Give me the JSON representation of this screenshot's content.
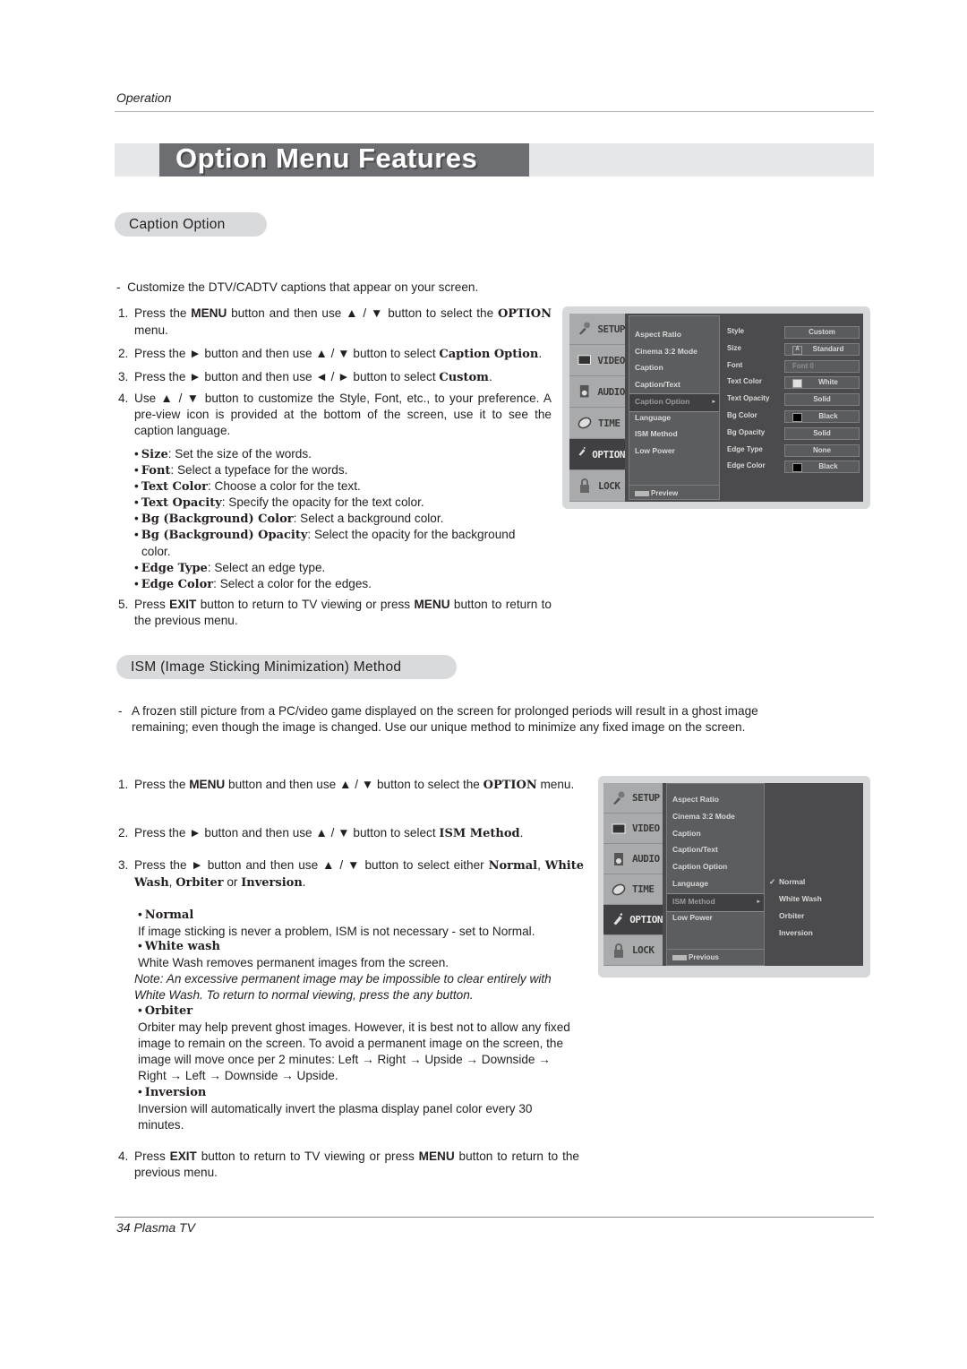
{
  "header": {
    "section": "Operation"
  },
  "title": "Option Menu Features",
  "caption_section": {
    "heading": "Caption Option",
    "intro": "Customize the DTV/CADTV captions that appear on your screen.",
    "steps": [
      {
        "num": "1.",
        "parts": [
          "Press the ",
          "MENU",
          " button and then use ▲ / ▼  button to select the ",
          "OPTION",
          " menu."
        ]
      },
      {
        "num": "2.",
        "parts": [
          "Press the ► button and then use ▲ / ▼ button to select ",
          "Caption Option",
          "."
        ]
      },
      {
        "num": "3.",
        "parts": [
          "Press the ► button and then use ◄ / ► button to select ",
          "Custom",
          "."
        ]
      },
      {
        "num": "4.",
        "text": "Use ▲ / ▼ button to customize the Style, Font, etc., to your preference. A pre-view icon is provided at the bottom of the screen, use it to see the caption language."
      },
      {
        "num": "5.",
        "parts": [
          "Press ",
          "EXIT",
          " button to return to TV viewing or press ",
          "MENU",
          " button to return to the previous menu."
        ]
      }
    ],
    "bullets": [
      {
        "term": "Size",
        "desc": ": Set the size of the words."
      },
      {
        "term": "Font",
        "desc": ": Select a typeface for the words."
      },
      {
        "term": "Text Color",
        "desc": ": Choose a color for the text."
      },
      {
        "term": "Text Opacity",
        "desc": ": Specify the opacity for the text color."
      },
      {
        "term": "Bg (Background) Color",
        "desc": ": Select a background color."
      },
      {
        "term": "Bg (Background) Opacity",
        "desc": ": Select the opacity for the background color."
      },
      {
        "term": "Edge Type",
        "desc": ": Select an edge type."
      },
      {
        "term": "Edge Color",
        "desc": ": Select a color for the edges."
      }
    ]
  },
  "tv_menu_1": {
    "sidebar": [
      "SETUP",
      "VIDEO",
      "AUDIO",
      "TIME",
      "OPTION",
      "LOCK"
    ],
    "active_sidebar": "OPTION",
    "menu_items": [
      "Aspect Ratio",
      "Cinema 3:2 Mode",
      "Caption",
      "Caption/Text",
      "Caption Option",
      "Language",
      "ISM Method",
      "Low Power"
    ],
    "selected_item": "Caption Option",
    "arrow": "▸",
    "preview": "Preview",
    "options": [
      {
        "label": "Style",
        "value": "Custom"
      },
      {
        "label": "Size",
        "value": "Standard",
        "icon": "A"
      },
      {
        "label": "Font",
        "value": "Font 0",
        "dim": true
      },
      {
        "label": "Text Color",
        "value": "White",
        "swatch": "#e0e0e0"
      },
      {
        "label": "Text Opacity",
        "value": "Solid"
      },
      {
        "label": "Bg Color",
        "value": "Black",
        "swatch": "#000000"
      },
      {
        "label": "Bg Opacity",
        "value": "Solid"
      },
      {
        "label": "Edge Type",
        "value": "None"
      },
      {
        "label": "Edge Color",
        "value": "Black",
        "swatch": "#000000"
      }
    ]
  },
  "ism_section": {
    "heading": "ISM (Image Sticking Minimization) Method",
    "intro": "A frozen still picture from a PC/video game displayed on the screen for prolonged periods will result in a ghost image remaining; even though the image is changed. Use our unique method to minimize any fixed image on the screen.",
    "steps": [
      {
        "num": "1.",
        "parts": [
          "Press the ",
          "MENU",
          " button and then use ▲ / ▼  button to select the ",
          "OPTION",
          " menu."
        ]
      },
      {
        "num": "2.",
        "parts": [
          "Press the ► button and then use ▲ / ▼ button to select ",
          "ISM Method",
          "."
        ]
      },
      {
        "num": "3.",
        "parts": [
          "Press the ► button and then use ▲ / ▼ button to select either ",
          "Normal",
          ", ",
          "White Wash",
          ", ",
          "Orbiter",
          " or ",
          "Inversion",
          "."
        ]
      },
      {
        "num": "4.",
        "parts": [
          "Press ",
          "EXIT",
          " button to return to TV viewing or press ",
          "MENU",
          " button to return to the previous menu."
        ]
      }
    ],
    "modes": [
      {
        "term": "Normal",
        "desc": "If image sticking is never a problem, ISM is not necessary - set to Normal."
      },
      {
        "term": "White wash",
        "desc": "White Wash removes permanent images from the screen.",
        "note": "Note: An excessive permanent image may be impossible to clear entirely with White Wash. To return to normal viewing, press the any button."
      },
      {
        "term": "Orbiter",
        "desc": "Orbiter may help prevent ghost images. However, it is best not to allow any fixed image to remain on the screen. To avoid a permanent image on the screen, the image will move once per 2 minutes: Left → Right → Upside → Downside → Right → Left → Downside → Upside."
      },
      {
        "term": "Inversion",
        "desc": "Inversion will automatically invert the plasma display panel color every 30 minutes."
      }
    ]
  },
  "tv_menu_2": {
    "sidebar": [
      "SETUP",
      "VIDEO",
      "AUDIO",
      "TIME",
      "OPTION",
      "LOCK"
    ],
    "active_sidebar": "OPTION",
    "menu_items": [
      "Aspect Ratio",
      "Cinema 3:2 Mode",
      "Caption",
      "Caption/Text",
      "Caption Option",
      "Language",
      "ISM Method",
      "Low Power"
    ],
    "selected_item": "ISM Method",
    "arrow": "▸",
    "preview": "Previous",
    "submenu": [
      "Normal",
      "White Wash",
      "Orbiter",
      "Inversion"
    ],
    "checked": "Normal",
    "check_mark": "✓"
  },
  "footer": {
    "page": "34  Plasma TV"
  }
}
